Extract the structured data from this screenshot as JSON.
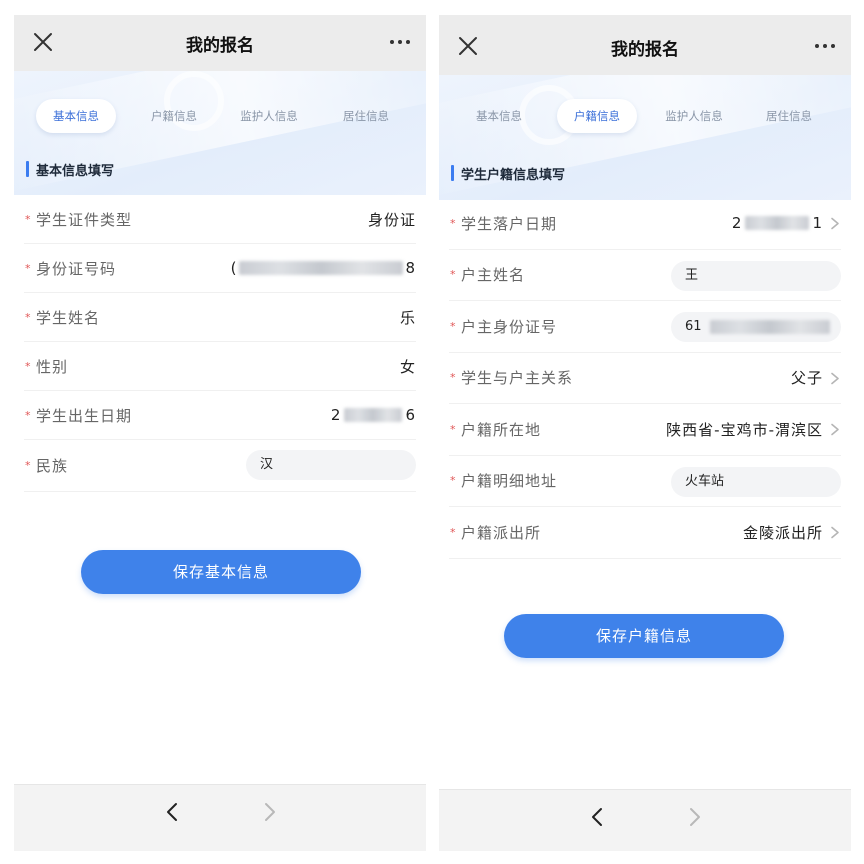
{
  "panels": [
    {
      "header": {
        "title": "我的报名"
      },
      "tabs": [
        {
          "label": "基本信息",
          "active": true
        },
        {
          "label": "户籍信息",
          "active": false
        },
        {
          "label": "监护人信息",
          "active": false
        },
        {
          "label": "居住信息",
          "active": false
        }
      ],
      "section_title": "基本信息填写",
      "fields": [
        {
          "label": "学生证件类型",
          "value": "身份证"
        },
        {
          "label": "身份证号码",
          "value_start": "(",
          "value_end": "8"
        },
        {
          "label": "学生姓名",
          "value": "乐"
        },
        {
          "label": "性别",
          "value": "女"
        },
        {
          "label": "学生出生日期",
          "value_start": "2",
          "value_end": "6"
        },
        {
          "label": "民族",
          "value": "汉"
        }
      ],
      "required_mark": "*",
      "save_label": "保存基本信息"
    },
    {
      "header": {
        "title": "我的报名"
      },
      "tabs": [
        {
          "label": "基本信息",
          "active": false
        },
        {
          "label": "户籍信息",
          "active": true
        },
        {
          "label": "监护人信息",
          "active": false
        },
        {
          "label": "居住信息",
          "active": false
        }
      ],
      "section_title": "学生户籍信息填写",
      "fields": [
        {
          "label": "学生落户日期",
          "value_start": "2",
          "value_end": "1"
        },
        {
          "label": "户主姓名",
          "value": "王"
        },
        {
          "label": "户主身份证号",
          "value_start": "61"
        },
        {
          "label": "学生与户主关系",
          "value": "父子"
        },
        {
          "label": "户籍所在地",
          "value": "陕西省-宝鸡市-渭滨区"
        },
        {
          "label": "户籍明细地址",
          "value": "火车站"
        },
        {
          "label": "户籍派出所",
          "value": "金陵派出所"
        }
      ],
      "required_mark": "*",
      "save_label": "保存户籍信息"
    }
  ],
  "icons": {
    "close": "close-icon",
    "more": "more-icon",
    "back": "chevron-left-icon",
    "forward": "chevron-right-icon",
    "row_arrow": "chevron-right-icon"
  },
  "colors": {
    "accent": "#3f82ea",
    "active_tab": "#3b6fd8",
    "required": "#e05656",
    "topbar": "#ececec"
  }
}
